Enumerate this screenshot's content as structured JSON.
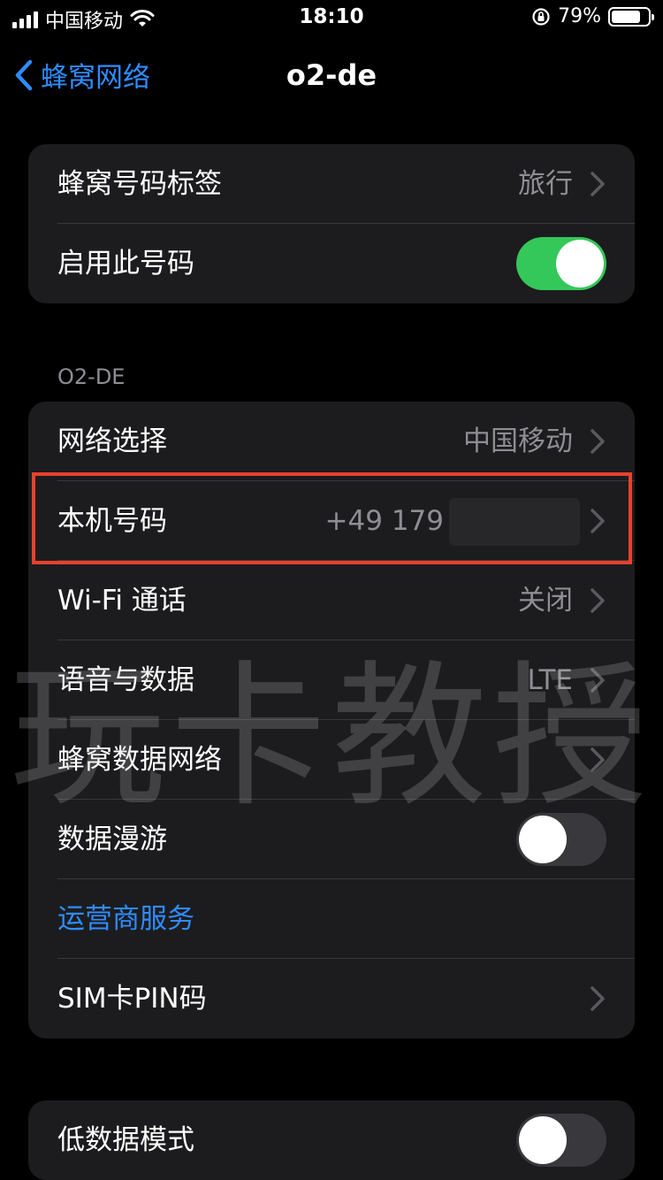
{
  "status_bar": {
    "carrier": "中国移动",
    "time": "18:10",
    "battery_percent": "79%",
    "battery_level": 0.79
  },
  "nav": {
    "back_label": "蜂窝网络",
    "title": "o2-de"
  },
  "group1": {
    "rows": [
      {
        "label": "蜂窝号码标签",
        "value": "旅行"
      },
      {
        "label": "启用此号码",
        "toggle_on": true
      }
    ]
  },
  "section_header": "O2-DE",
  "group2": {
    "rows": [
      {
        "label": "网络选择",
        "value": "中国移动"
      },
      {
        "label": "本机号码",
        "value": "+49 179"
      },
      {
        "label": "Wi-Fi 通话",
        "value": "关闭"
      },
      {
        "label": "语音与数据",
        "value": "LTE"
      },
      {
        "label": "蜂窝数据网络"
      },
      {
        "label": "数据漫游",
        "toggle_on": false
      },
      {
        "label": "运营商服务"
      },
      {
        "label": "SIM卡PIN码"
      }
    ]
  },
  "group3": {
    "rows": [
      {
        "label": "低数据模式",
        "toggle_on": false
      }
    ]
  },
  "watermark": "玩卡教授",
  "colors": {
    "accent": "#2f8cff",
    "toggle_on": "#34c759",
    "highlight": "#e8412c",
    "cell_bg": "#1c1c1e",
    "page_bg": "#000000"
  }
}
